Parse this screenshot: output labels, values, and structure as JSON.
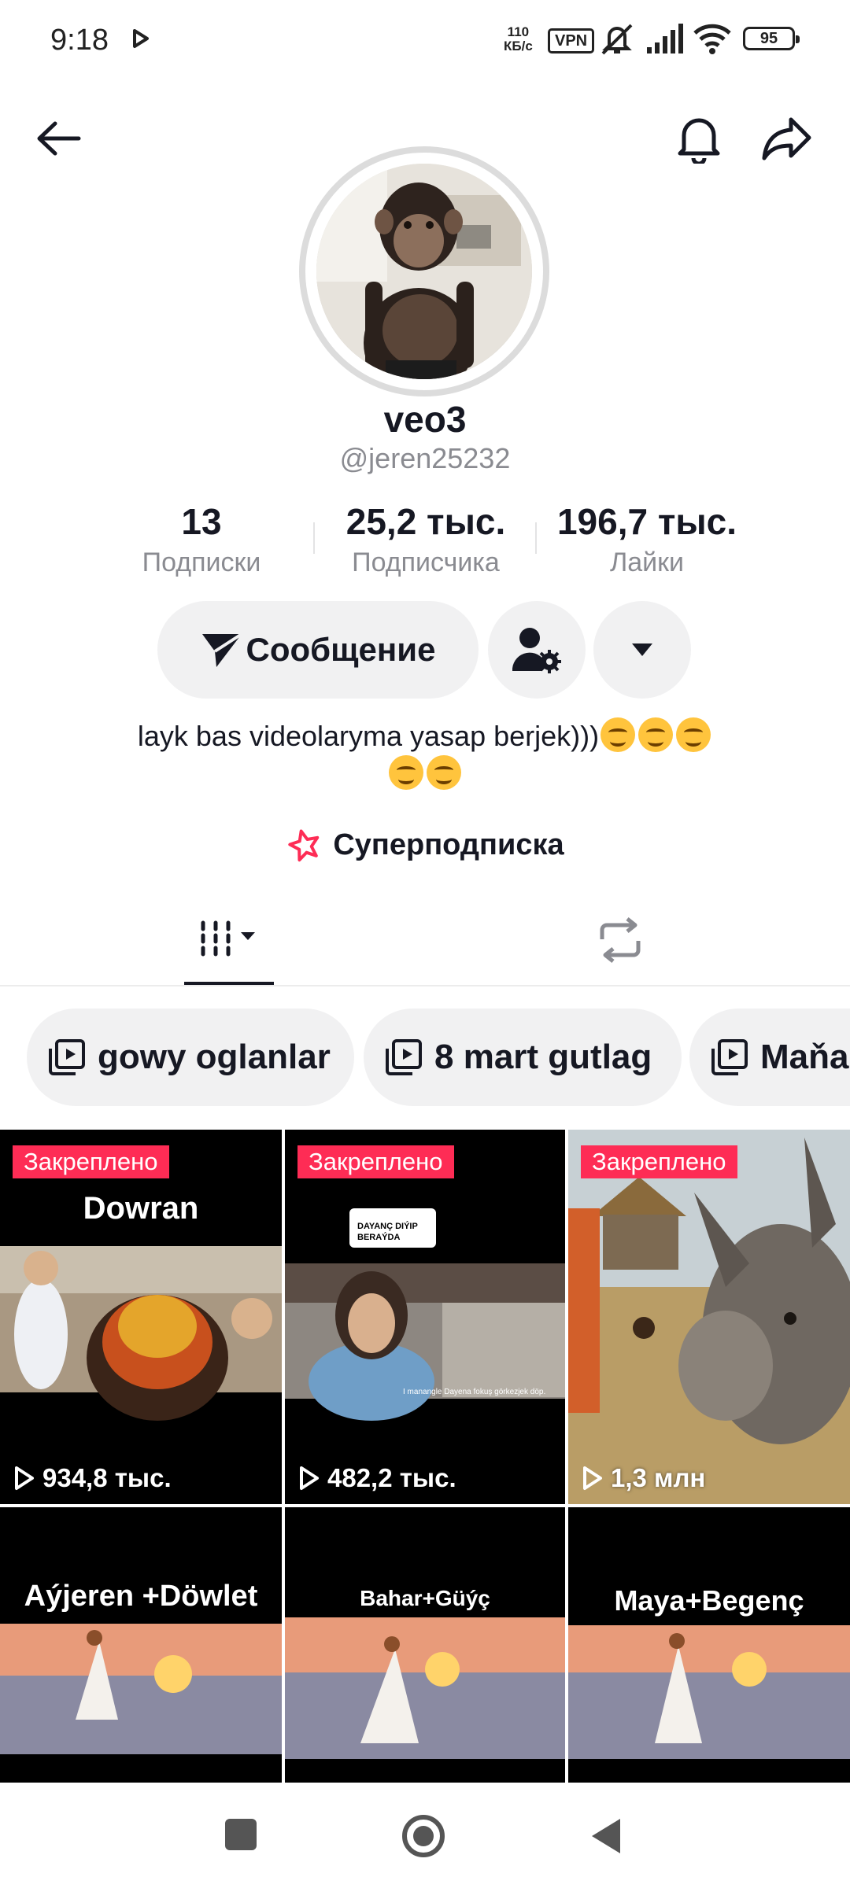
{
  "status": {
    "time": "9:18",
    "net_speed_top": "110",
    "net_speed_unit": "КБ/с",
    "vpn": "VPN",
    "battery": "95"
  },
  "profile": {
    "display_name": "veo3",
    "handle": "@jeren25232",
    "stats": [
      {
        "value": "13",
        "label": "Подписки"
      },
      {
        "value": "25,2 тыс.",
        "label": "Подписчика"
      },
      {
        "value": "196,7 тыс.",
        "label": "Лайки"
      }
    ],
    "message_button": "Сообщение",
    "bio_line1": "layk bas videolaryma yasap berjek)))",
    "superfollow": "Суперподписка"
  },
  "playlists": [
    {
      "label": "gowy oglanlar"
    },
    {
      "label": "8 mart gutlag"
    },
    {
      "label": "Maňa"
    }
  ],
  "videos": [
    {
      "pinned": "Закреплено",
      "caption": "Dowran",
      "views": "934,8 тыс."
    },
    {
      "pinned": "Закреплено",
      "caption": "",
      "views": "482,2 тыс."
    },
    {
      "pinned": "Закреплено",
      "caption": "",
      "views": "1,3 млн"
    },
    {
      "pinned": "",
      "caption": "Aýjeren +Döwlet",
      "views": ""
    },
    {
      "pinned": "",
      "caption": "Bahar+Güýç",
      "views": ""
    },
    {
      "pinned": "",
      "caption": "Maya+Begenç",
      "views": ""
    }
  ],
  "comment_overlay": {
    "line1": "DAYANÇ DIÝIP",
    "line2": "BERAÝDA"
  },
  "subtitle_text": "I manangle Dayena fokuş görkezjek döp.",
  "colors": {
    "accent": "#fe2c55",
    "chip_bg": "#f1f1f2",
    "muted": "#8a8b91"
  }
}
